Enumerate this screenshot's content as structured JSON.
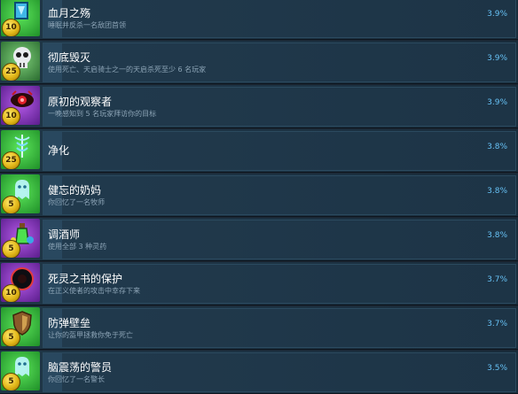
{
  "achievements": [
    {
      "title": "血月之殇",
      "desc": "睡眠并反杀一名敌团首领",
      "percent": "3.9%",
      "points": "10",
      "icon": "blue-rune-icon",
      "bg": "#2fb83a"
    },
    {
      "title": "彻底毁灭",
      "desc": "使用死亡、天启骑士之一的天启杀死至少 6 名玩家",
      "percent": "3.9%",
      "points": "25",
      "icon": "skull-icon",
      "bg": "#3a8a3a"
    },
    {
      "title": "原初的观察者",
      "desc": "一晚感知到 5 名玩家拜访你的目标",
      "percent": "3.9%",
      "points": "10",
      "icon": "crimson-eye-icon",
      "bg": "#7a2bb8"
    },
    {
      "title": "净化",
      "desc": "",
      "percent": "3.8%",
      "points": "25",
      "icon": "caduceus-icon",
      "bg": "#2fb83a"
    },
    {
      "title": "健忘的奶妈",
      "desc": "你回忆了一名牧师",
      "percent": "3.8%",
      "points": "5",
      "icon": "ghost-icon",
      "bg": "#2fb83a"
    },
    {
      "title": "调酒师",
      "desc": "使用全部 3 种灵药",
      "percent": "3.8%",
      "points": "5",
      "icon": "potion-icon",
      "bg": "#7a2bb8"
    },
    {
      "title": "死灵之书的保护",
      "desc": "在正义使者的攻击中幸存下来",
      "percent": "3.7%",
      "points": "10",
      "icon": "necronomicon-icon",
      "bg": "#7a2bb8"
    },
    {
      "title": "防弹壁垒",
      "desc": "让你的盔甲拯救你免于死亡",
      "percent": "3.7%",
      "points": "5",
      "icon": "shield-icon",
      "bg": "#2fb83a"
    },
    {
      "title": "脑震荡的警员",
      "desc": "你回忆了一名警长",
      "percent": "3.5%",
      "points": "5",
      "icon": "ghost-icon",
      "bg": "#2fb83a"
    }
  ],
  "percent_values": [
    3.9,
    3.9,
    3.9,
    3.8,
    3.8,
    3.8,
    3.7,
    3.7,
    3.5
  ]
}
